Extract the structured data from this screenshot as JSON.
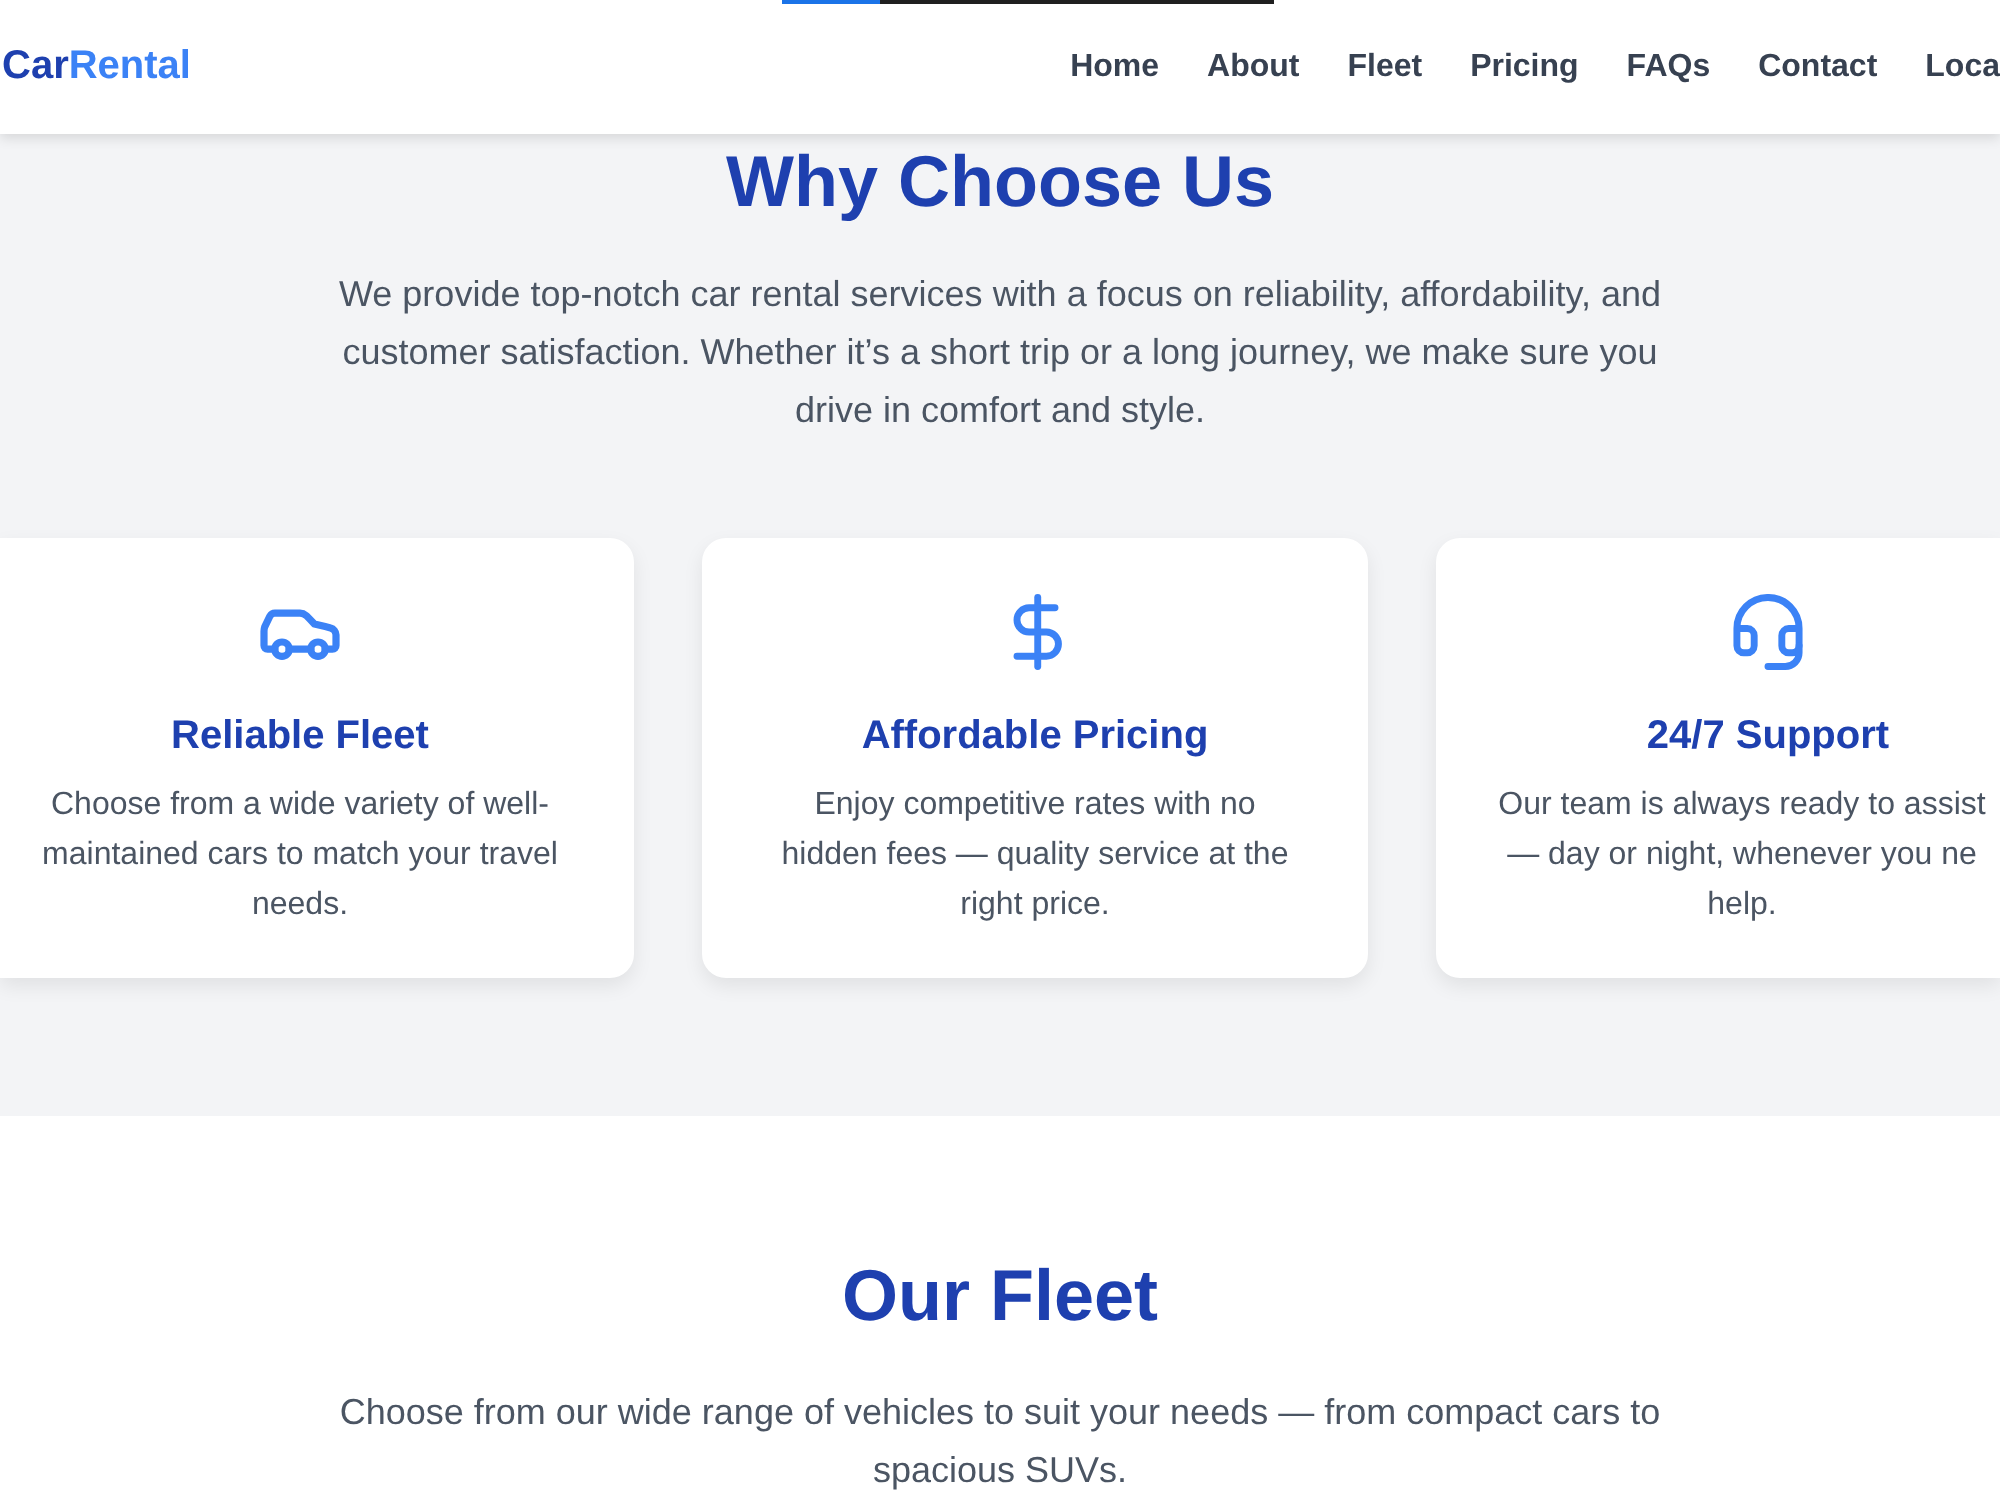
{
  "top_progress": {
    "level": 0.2
  },
  "header": {
    "logo": {
      "primary": "Car",
      "accent": "Rental"
    },
    "nav": [
      "Home",
      "About",
      "Fleet",
      "Pricing",
      "FAQs",
      "Contact",
      "Loca"
    ]
  },
  "why_section": {
    "title": "Why Choose Us",
    "intro": "We provide top-notch car rental services with a focus on reliability, affordability, and customer satisfaction. Whether it’s a short trip or a long journey, we make sure you drive in comfort and style.",
    "cards": [
      {
        "title": "Reliable Fleet",
        "description": "Choose from a wide variety of well-maintained cars to match your travel needs."
      },
      {
        "title": "Affordable Pricing",
        "description": "Enjoy competitive rates with no hidden fees — quality service at the right price."
      },
      {
        "title": "24/7 Support",
        "description": "Our team is always ready to assist\n— day or night, whenever you ne\nhelp."
      }
    ]
  },
  "fleet_section": {
    "title": "Our Fleet",
    "intro": "Choose from our wide range of vehicles to suit your needs — from compact cars to spacious SUVs."
  }
}
